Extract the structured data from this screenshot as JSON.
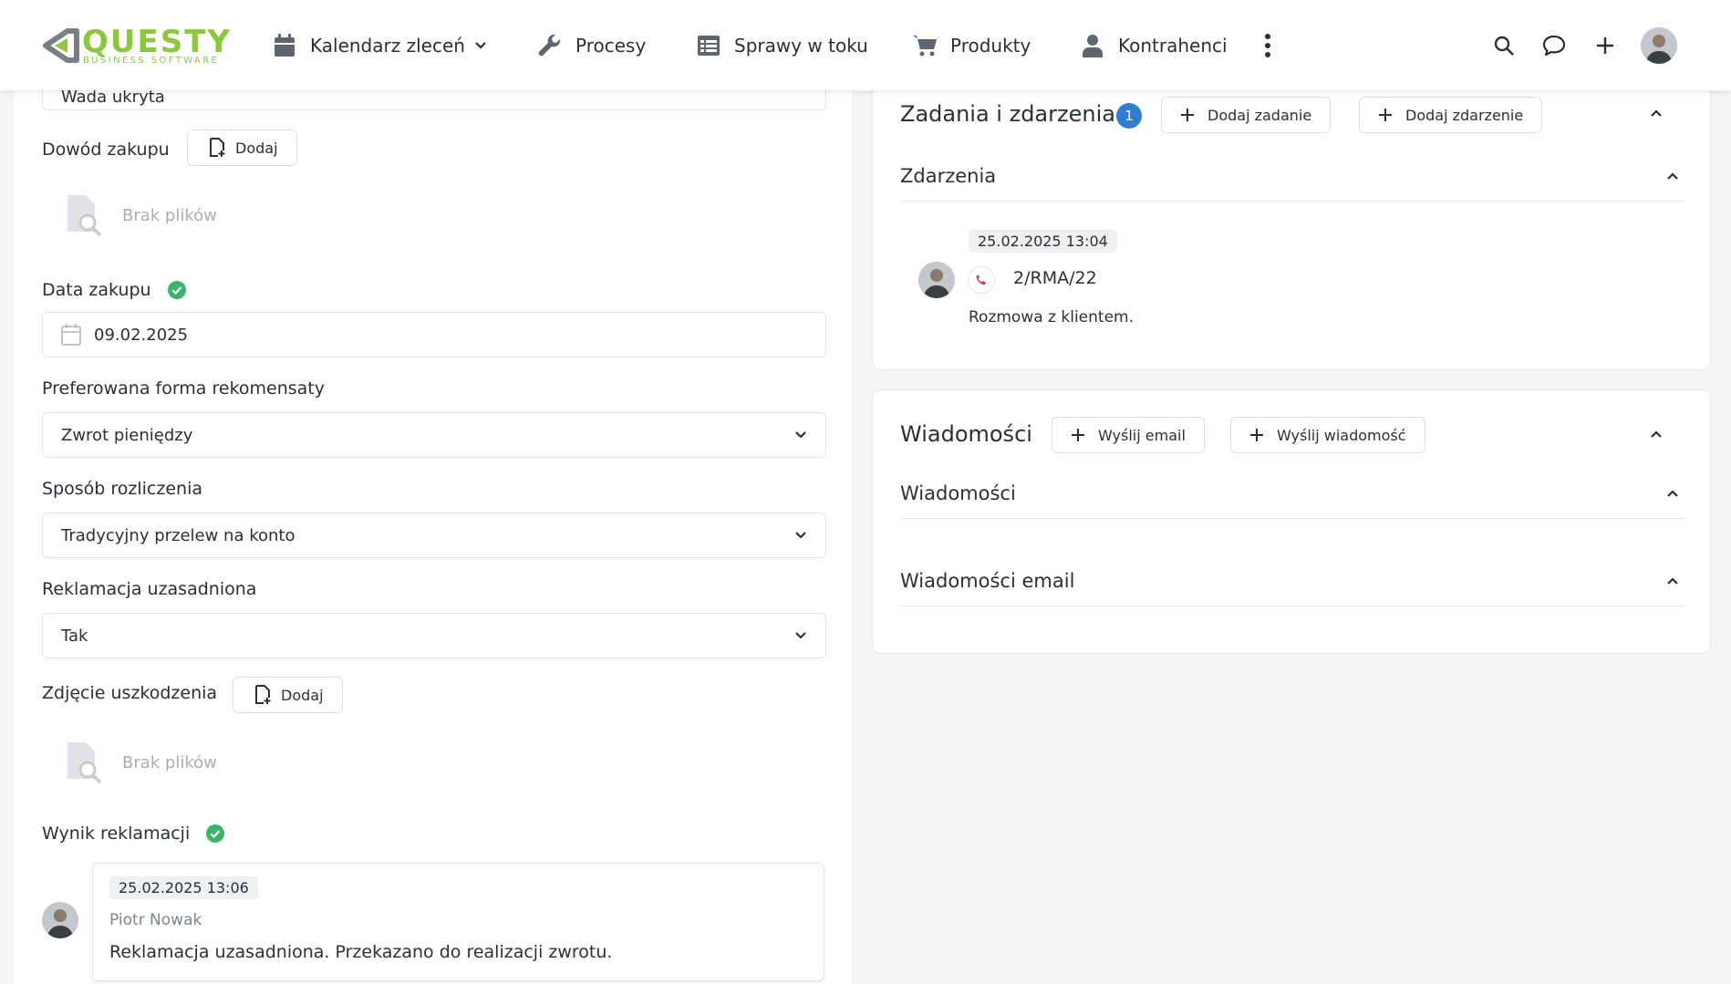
{
  "app": {
    "logo_text": "QUESTY",
    "logo_subtext": "BUSINESS SOFTWARE"
  },
  "nav": {
    "items": [
      {
        "label": "Kalendarz zleceń",
        "icon": "calendar-icon"
      },
      {
        "label": "Procesy",
        "icon": "wrench-icon"
      },
      {
        "label": "Sprawy w toku",
        "icon": "list-icon"
      },
      {
        "label": "Produkty",
        "icon": "cart-icon"
      },
      {
        "label": "Kontrahenci",
        "icon": "user-icon"
      }
    ],
    "right_icons": [
      "search-icon",
      "chat-icon",
      "plus-icon",
      "avatar"
    ]
  },
  "form": {
    "wada_partial": "Wada ukryta",
    "dowod_zakupu": {
      "label": "Dowód zakupu",
      "button": "Dodaj",
      "empty": "Brak plików"
    },
    "data_zakupu": {
      "label": "Data zakupu",
      "value": "09.02.2025"
    },
    "rekompensata": {
      "label": "Preferowana forma rekomensaty",
      "value": "Zwrot pieniędzy"
    },
    "rozliczenie": {
      "label": "Sposób rozliczenia",
      "value": "Tradycyjny przelew na konto"
    },
    "uzasadniona": {
      "label": "Reklamacja uzasadniona",
      "value": "Tak"
    },
    "zdjecie": {
      "label": "Zdjęcie uszkodzenia",
      "button": "Dodaj",
      "empty": "Brak plików"
    },
    "wynik": {
      "label": "Wynik reklamacji",
      "date": "25.02.2025 13:06",
      "author": "Piotr Nowak",
      "text": "Reklamacja uzasadniona. Przekazano do realizacji zwrotu."
    }
  },
  "tasks_card": {
    "title": "Zadania i zdarzenia",
    "badge": "1",
    "add_task": "Dodaj zadanie",
    "add_event": "Dodaj zdarzenie",
    "section": "Zdarzenia",
    "event": {
      "date": "25.02.2025 13:04",
      "number": "2/RMA/22",
      "description": "Rozmowa z klientem."
    }
  },
  "messages_card": {
    "title": "Wiadomości",
    "send_email": "Wyślij email",
    "send_message": "Wyślij wiadomość",
    "section_messages": "Wiadomości",
    "section_emails": "Wiadomości email"
  },
  "colors": {
    "brand_green": "#8dc63f",
    "badge_blue": "#2d7dd2",
    "ok_green": "#3db36b",
    "phone_red": "#d63b3b"
  }
}
